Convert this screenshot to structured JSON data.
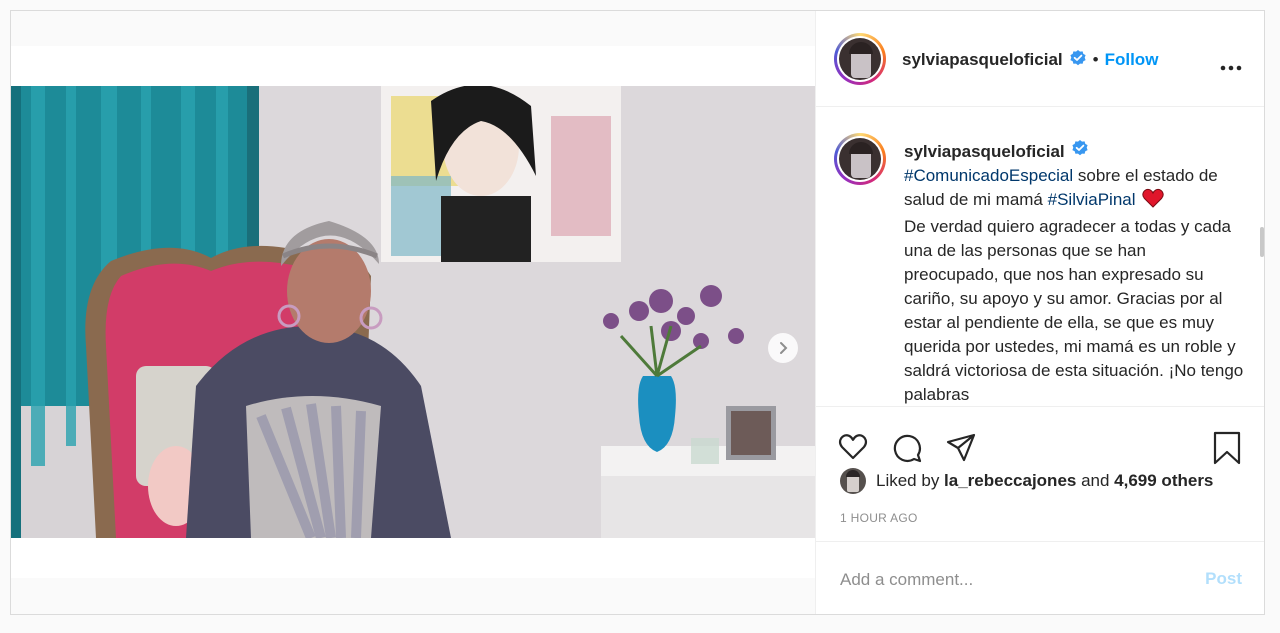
{
  "post": {
    "author": {
      "username": "sylviapasqueloficial",
      "verified": true,
      "avatar_icon": "profile-photo"
    },
    "header": {
      "separator": "•",
      "follow_label": "Follow",
      "more_icon": "ellipsis-icon"
    },
    "caption": {
      "username": "sylviapasqueloficial",
      "hashtag_1": "#ComunicadoEspecial",
      "text_1": " sobre el estado de salud de mi mamá ",
      "hashtag_2": "#SilviaPinal",
      "emoji": "❤️",
      "text_2": "De verdad quiero agradecer a todas y cada una de las personas que se han preocupado, que nos han expresado su cariño, su apoyo y su amor. Gracias por al estar al pendiente de ella, se que es muy querida por ustedes, mi mamá es un roble y saldrá victoriosa de esta situación. ¡No tengo palabras"
    },
    "actions": {
      "like_icon": "heart-icon",
      "comment_icon": "speech-bubble-icon",
      "share_icon": "paper-plane-icon",
      "save_icon": "bookmark-icon"
    },
    "likes": {
      "prefix": "Liked by ",
      "user": "la_rebeccajones",
      "middle": " and ",
      "count": "4,699 others"
    },
    "timestamp": "1 HOUR AGO",
    "comment": {
      "placeholder": "Add a comment...",
      "value": "",
      "post_label": "Post"
    }
  },
  "colors": {
    "accent": "#0095f6",
    "hashtag": "#00376b",
    "muted": "#8e8e8e",
    "post_disabled": "#b2dffc",
    "verified": "#3897f0",
    "heart_emoji": "#e0162b"
  }
}
